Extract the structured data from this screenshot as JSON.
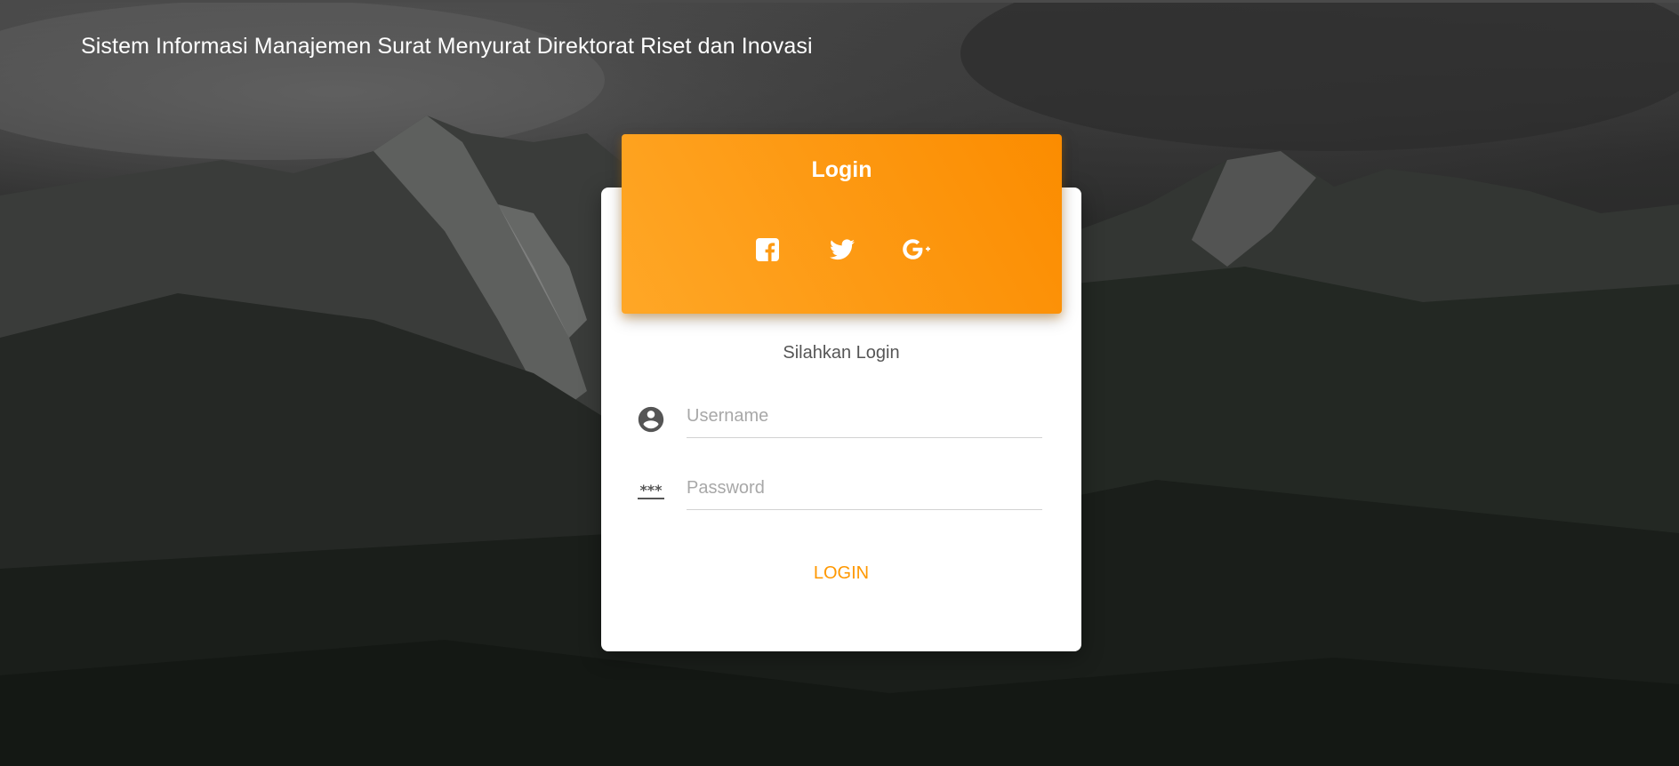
{
  "header": {
    "site_title": "Sistem Informasi Manajemen Surat Menyurat Direktorat Riset dan Inovasi"
  },
  "login_card": {
    "title": "Login",
    "social_icons": [
      "facebook-square-icon",
      "twitter-icon",
      "google-plus-icon"
    ],
    "subtitle": "Silahkan Login",
    "username": {
      "placeholder": "Username",
      "value": "",
      "icon": "account-circle-icon"
    },
    "password": {
      "placeholder": "Password",
      "value": "",
      "icon": "password-icon"
    },
    "login_button_label": "LOGIN"
  },
  "colors": {
    "accent": "#ff9800",
    "header_gradient_start": "#ffa726",
    "header_gradient_end": "#fb8c00",
    "card_background": "#ffffff"
  }
}
